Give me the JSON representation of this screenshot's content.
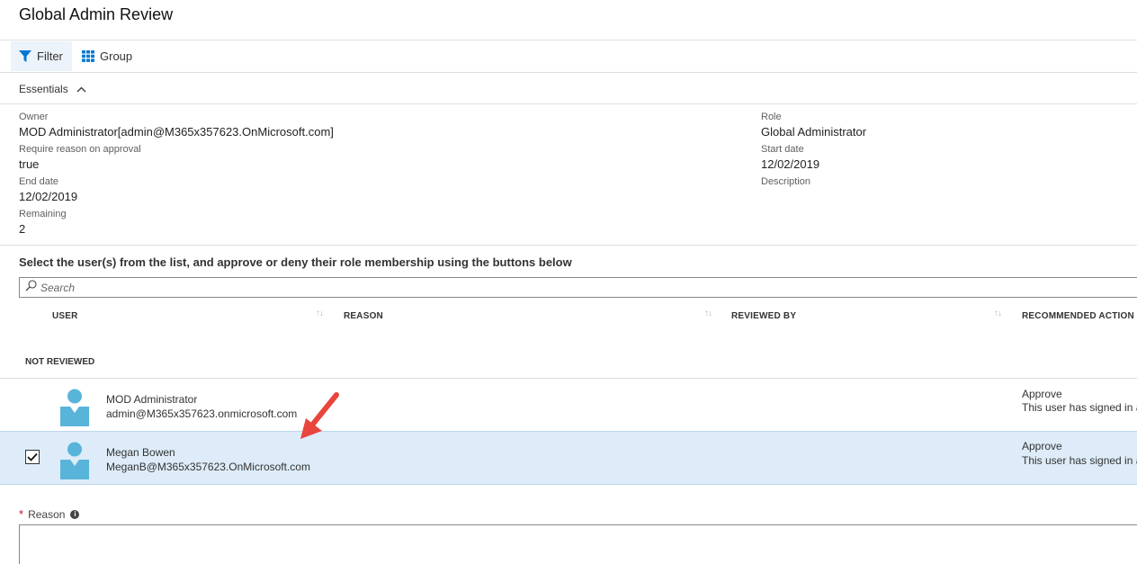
{
  "page": {
    "title": "Global Admin Review"
  },
  "toolbar": {
    "filter_label": "Filter",
    "group_label": "Group"
  },
  "essentials": {
    "label": "Essentials",
    "left": [
      {
        "label": "Owner",
        "value": "MOD Administrator[admin@M365x357623.OnMicrosoft.com]"
      },
      {
        "label": "Require reason on approval",
        "value": "true"
      },
      {
        "label": "End date",
        "value": "12/02/2019"
      },
      {
        "label": "Remaining",
        "value": "2"
      }
    ],
    "right": [
      {
        "label": "Role",
        "value": "Global Administrator"
      },
      {
        "label": "Start date",
        "value": "12/02/2019"
      },
      {
        "label": "Description",
        "value": ""
      }
    ]
  },
  "instructions": "Select the user(s) from the list, and approve or deny their role membership using the buttons below",
  "search": {
    "placeholder": "Search"
  },
  "table": {
    "columns": [
      "USER",
      "REASON",
      "REVIEWED BY",
      "RECOMMENDED ACTION"
    ],
    "group_label": "NOT REVIEWED",
    "rows": [
      {
        "name": "MOD Administrator",
        "email": "admin@M365x357623.onmicrosoft.com",
        "action": "Approve",
        "action_detail": "This user has signed in a",
        "selected": false
      },
      {
        "name": "Megan Bowen",
        "email": "MeganB@M365x357623.OnMicrosoft.com",
        "action": "Approve",
        "action_detail": "This user has signed in a",
        "selected": true
      }
    ]
  },
  "reason": {
    "label": "Reason",
    "value": ""
  },
  "colors": {
    "selected_row": "#ddecf8",
    "accent": "#0078d4",
    "avatar": "#59b4d9",
    "arrow": "#e8453c",
    "required": "#c50f1f"
  },
  "icons": {
    "filter": "filter-icon",
    "group": "grid-icon",
    "essentials_toggle": "chevron-up-icon",
    "search": "search-icon",
    "info": "info-icon",
    "avatar": "user-avatar-icon",
    "checkbox": "checkmark-icon"
  }
}
